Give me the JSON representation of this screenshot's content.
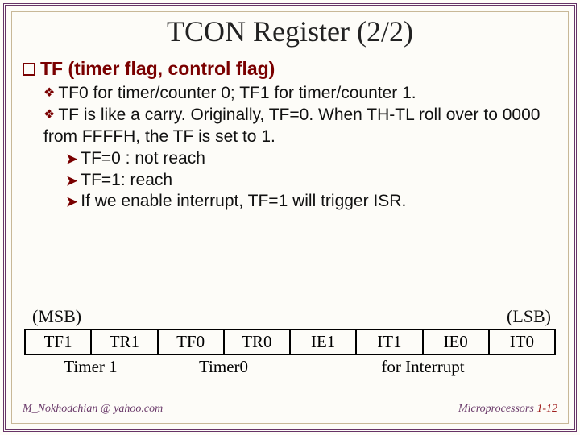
{
  "title": "TCON Register (2/2)",
  "sections": {
    "tf": {
      "heading_bold": "TF",
      "heading_rest": "(timer flag, control flag)",
      "items": {
        "a": "TF0 for timer/counter 0; TF1 for timer/counter 1.",
        "b": "TF is like a carry. Originally, TF=0. When TH-TL roll over to 0000 from FFFFH, the TF is set to 1.",
        "sub1": "TF=0 : not reach",
        "sub2": "TF=1: reach",
        "sub3": "If we enable interrupt, TF=1 will trigger ISR."
      }
    }
  },
  "register": {
    "msb": "(MSB)",
    "lsb": "(LSB)",
    "bits": [
      "TF1",
      "TR1",
      "TF0",
      "TR0",
      "IE1",
      "IT1",
      "IE0",
      "IT0"
    ],
    "groups": [
      "Timer 1",
      "Timer0",
      "for Interrupt"
    ]
  },
  "footer": {
    "left": "M_Nokhodchian @ yahoo.com",
    "right": "Microprocessors",
    "page": "1-12"
  }
}
